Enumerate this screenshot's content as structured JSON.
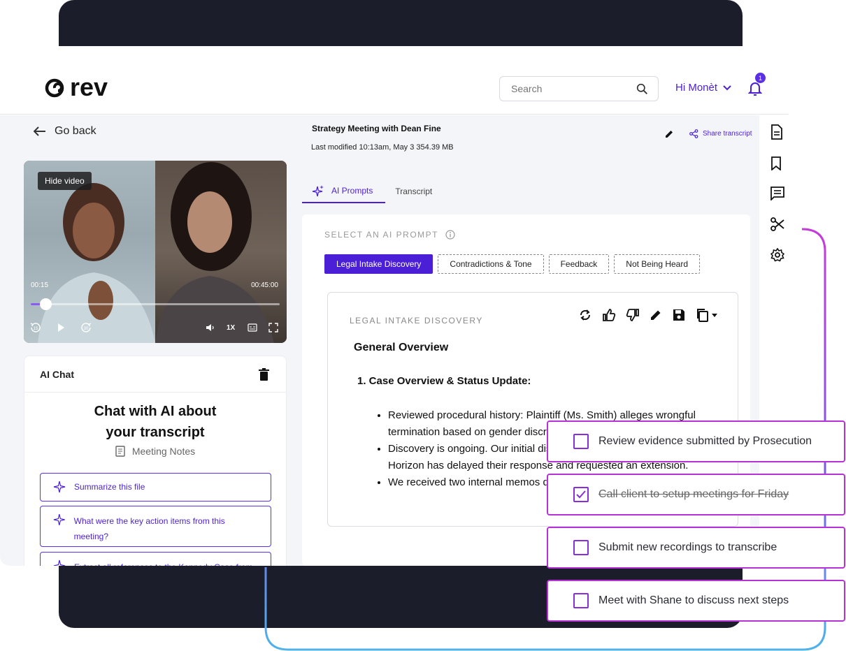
{
  "brand": {
    "logo_text": "rev"
  },
  "header": {
    "search_placeholder": "Search",
    "greeting": "Hi Monèt",
    "notification_count": "1"
  },
  "left": {
    "go_back": "Go back",
    "video": {
      "hide_label": "Hide video",
      "current_time": "00:15",
      "duration": "00:45:00",
      "progress": 0.06,
      "speed": "1X",
      "skip_back": "15",
      "skip_forward": "30"
    },
    "chat": {
      "header_title": "AI Chat",
      "title_line1": "Chat with AI about",
      "title_line2": "your transcript",
      "subtitle": "Meeting Notes",
      "suggestions": [
        "Summarize this file",
        "What were the key action items from this meeting?",
        "Extract all references to the Kennedy Case from"
      ]
    }
  },
  "file": {
    "title": "Strategy Meeting with Dean Fine",
    "meta": "Last modified 10:13am, May 3 354.39 MB",
    "share_label": "Share transcript"
  },
  "tabs": [
    {
      "label": "AI Prompts",
      "active": true
    },
    {
      "label": "Transcript",
      "active": false
    }
  ],
  "prompts": {
    "section_label": "SELECT AN AI PROMPT",
    "buttons": [
      {
        "label": "Legal Intake Discovery",
        "active": true
      },
      {
        "label": "Contradictions & Tone",
        "active": false
      },
      {
        "label": "Feedback",
        "active": false
      },
      {
        "label": "Not Being Heard",
        "active": false
      }
    ]
  },
  "result": {
    "label": "LEGAL INTAKE DISCOVERY",
    "heading": "General Overview",
    "section": "1. Case Overview & Status Update:",
    "bullets": [
      "Reviewed procedural history: Plaintiff (Ms. Smith) alleges wrongful termination based on gender discrimination under Title VII.",
      "Discovery is ongoing. Our initial disclosures were submitted on time; Horizon has delayed their response and requested an extension.",
      "We received two internal memos during discovery that may"
    ]
  },
  "todos": [
    {
      "text": "Review evidence submitted by Prosecution",
      "checked": false
    },
    {
      "text": "Call client to setup meetings for Friday",
      "checked": true
    },
    {
      "text": "Submit new recordings to transcribe",
      "checked": false
    },
    {
      "text": "Meet with Shane to discuss next steps",
      "checked": false
    }
  ],
  "colors": {
    "accent": "#4b1fd6",
    "dark_panel": "#1c1d2b",
    "todo_border": "#b731d6",
    "line_gradient_start": "#c43bd8",
    "line_gradient_end": "#4fb3ea"
  }
}
